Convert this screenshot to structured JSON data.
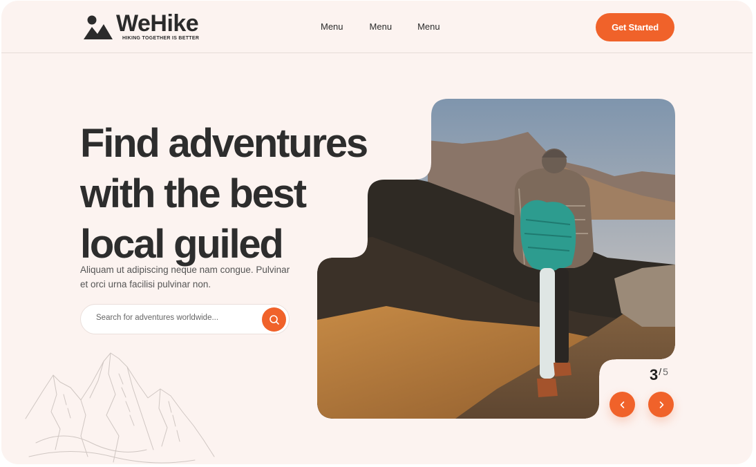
{
  "brand": {
    "name": "WeHike",
    "tagline": "HIKING TOGETHER IS BETTER"
  },
  "nav": {
    "items": [
      "Menu",
      "Menu",
      "Menu"
    ]
  },
  "header": {
    "cta_label": "Get Started"
  },
  "hero": {
    "headline_lines": [
      "Find adventures",
      "with the best",
      "local guiled"
    ],
    "subtitle": "Aliquam ut adipiscing neque nam congue. Pulvinar et orci urna facilisi pulvinar non.",
    "search_placeholder": "Search for adventures worldwide..."
  },
  "slider": {
    "current": "3",
    "separator": "/",
    "total": "5"
  },
  "icons": {
    "logo": "mountain-person-logo-icon",
    "search": "search-icon",
    "prev": "chevron-left-icon",
    "next": "chevron-right-icon",
    "decor": "mountain-sketch-illustration"
  },
  "colors": {
    "accent": "#f0622a",
    "background": "#fcf3f0",
    "text": "#2d2d2d"
  }
}
